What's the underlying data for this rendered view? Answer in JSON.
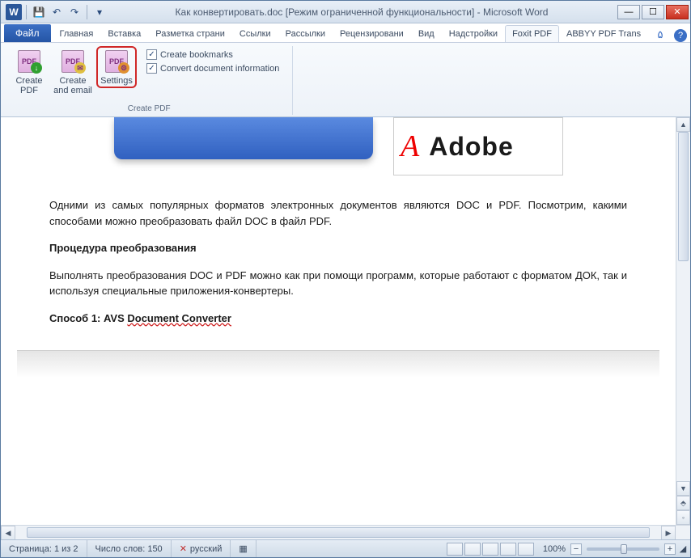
{
  "title": "Как конвертировать.doc [Режим ограниченной функциональности] - Microsoft Word",
  "tabs": {
    "file": "Файл",
    "items": [
      "Главная",
      "Вставка",
      "Разметка страни",
      "Ссылки",
      "Рассылки",
      "Рецензировани",
      "Вид",
      "Надстройки",
      "Foxit PDF",
      "ABBYY PDF Trans"
    ],
    "active_index": 8
  },
  "ribbon": {
    "group_label": "Create PDF",
    "buttons": {
      "create_pdf": "Create PDF",
      "create_email": "Create and email",
      "settings": "Settings"
    },
    "checks": {
      "bookmarks": "Create bookmarks",
      "docinfo": "Convert document information"
    }
  },
  "document": {
    "adobe_label": "Adobe",
    "para1": "Одними из самых популярных форматов электронных документов являются DOC и PDF. Посмотрим, какими способами можно преобразовать файл DOC в файл PDF.",
    "heading1": "Процедура преобразования",
    "para2": "Выполнять преобразования DOC и PDF можно как при помощи программ, которые работают с форматом ДОК, так и используя специальные приложения-конвертеры.",
    "heading2_prefix": "Способ 1: AVS ",
    "heading2_underlined": "Document Converter"
  },
  "status": {
    "page": "Страница: 1 из 2",
    "words": "Число слов: 150",
    "language": "русский",
    "zoom": "100%"
  }
}
